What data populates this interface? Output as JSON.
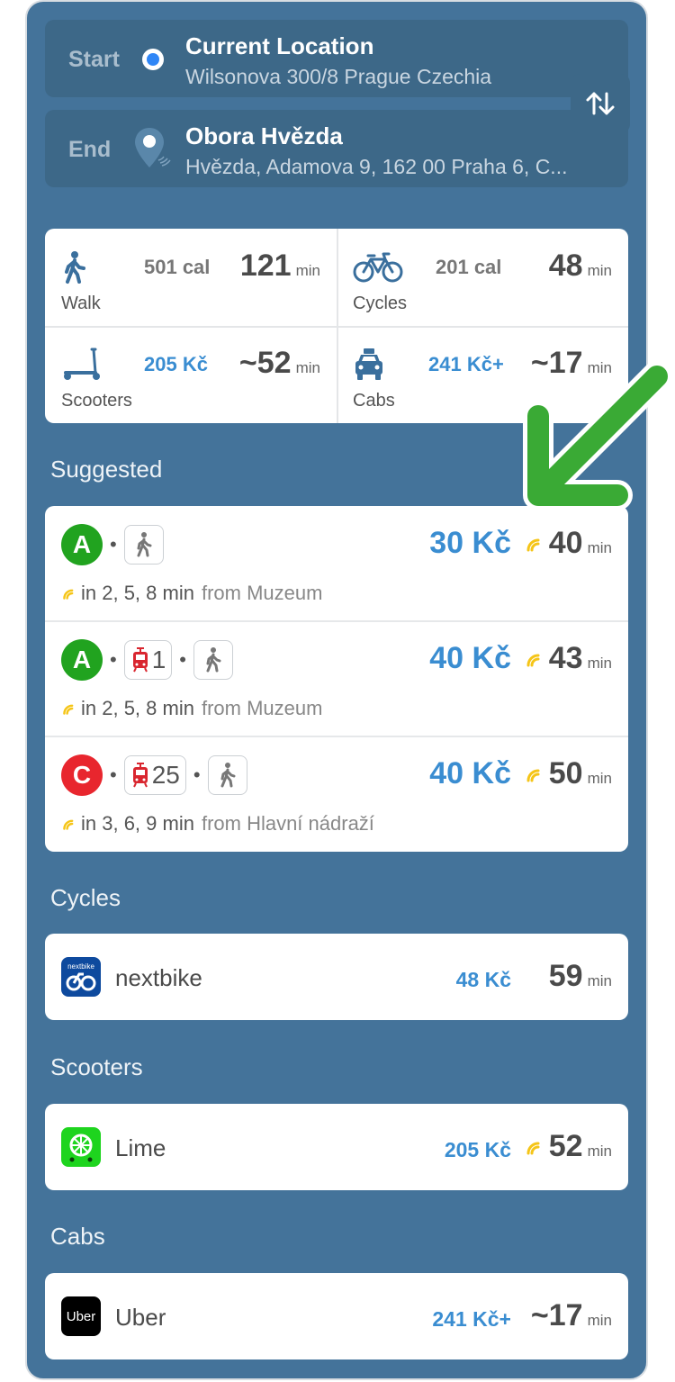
{
  "route": {
    "start": {
      "label": "Start",
      "title": "Current Location",
      "subtitle": "Wilsonova 300/8 Prague Czechia"
    },
    "end": {
      "label": "End",
      "title": "Obora Hvězda",
      "subtitle": "Hvězda, Adamova 9, 162 00 Praha 6, C..."
    },
    "swap_icon": "swap-arrows-icon"
  },
  "modes": [
    {
      "label": "Walk",
      "icon": "walk-icon",
      "extra": "501 cal",
      "time": "121",
      "unit": "min"
    },
    {
      "label": "Cycles",
      "icon": "bicycle-icon",
      "extra": "201 cal",
      "time": "48",
      "unit": "min"
    },
    {
      "label": "Scooters",
      "icon": "scooter-icon",
      "extra": "205 Kč",
      "time": "~52",
      "unit": "min"
    },
    {
      "label": "Cabs",
      "icon": "taxi-icon",
      "extra": "241 Kč+",
      "time": "~17",
      "unit": "min"
    }
  ],
  "sections": {
    "suggested": "Suggested",
    "cycles": "Cycles",
    "scooters": "Scooters",
    "cabs": "Cabs"
  },
  "suggested": [
    {
      "line": "A",
      "line_color": "#21a31f",
      "tram": "",
      "price": "30 Kč",
      "time": "40",
      "unit": "min",
      "departures": "in 2, 5, 8 min",
      "from": "from Muzeum"
    },
    {
      "line": "A",
      "line_color": "#21a31f",
      "tram": "1",
      "price": "40 Kč",
      "time": "43",
      "unit": "min",
      "departures": "in 2, 5, 8 min",
      "from": "from Muzeum"
    },
    {
      "line": "C",
      "line_color": "#e8262e",
      "tram": "25",
      "price": "40 Kč",
      "time": "50",
      "unit": "min",
      "departures": "in 3, 6, 9 min",
      "from": "from Hlavní nádraží"
    }
  ],
  "providers": {
    "cycles": {
      "name": "nextbike",
      "price": "48 Kč",
      "time": "59",
      "unit": "min",
      "logo_text": "nextbike"
    },
    "scooters": {
      "name": "Lime",
      "price": "205 Kč",
      "time": "52",
      "unit": "min"
    },
    "cabs": {
      "name": "Uber",
      "price": "241 Kč+",
      "time": "~17",
      "unit": "min",
      "logo_text": "Uber"
    }
  },
  "colors": {
    "background": "#44739a",
    "price_blue": "#3a8dd1",
    "realtime_yellow": "#f5c518",
    "arrow_green": "#3aaa35"
  }
}
